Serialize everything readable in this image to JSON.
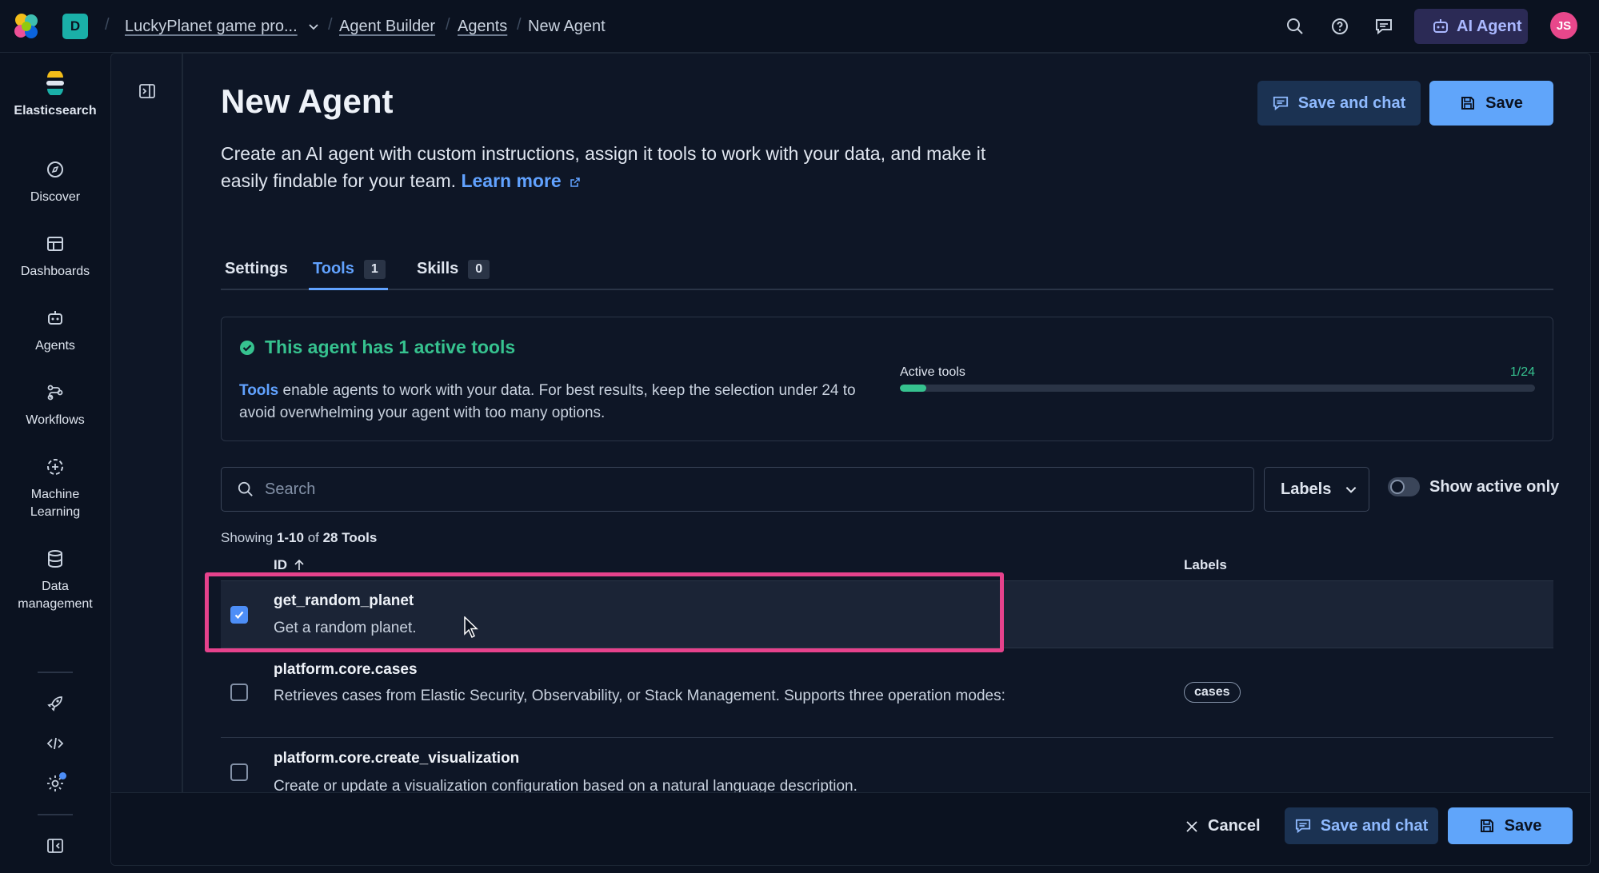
{
  "colors": {
    "accent": "#61a2ff",
    "success": "#36c28f",
    "highlight": "#e6428c",
    "space_badge": "#1ab0a8",
    "avatar": "#e8478b"
  },
  "header": {
    "space_initial": "D",
    "breadcrumbs": [
      "LuckyPlanet game pro...",
      "Agent Builder",
      "Agents",
      "New Agent"
    ],
    "ai_agent_label": "AI Agent",
    "avatar_initials": "JS"
  },
  "nav": {
    "items": [
      {
        "label": "Elasticsearch",
        "icon": "elasticsearch-logo-icon"
      },
      {
        "label": "Discover",
        "icon": "compass-icon"
      },
      {
        "label": "Dashboards",
        "icon": "dashboard-icon"
      },
      {
        "label": "Agents",
        "icon": "robot-icon"
      },
      {
        "label": "Workflows",
        "icon": "workflow-icon"
      },
      {
        "label": "Machine Learning",
        "icon": "machine-learning-icon"
      },
      {
        "label": "Data management",
        "icon": "database-icon"
      }
    ],
    "bottom_icons": [
      "rocket-icon",
      "code-icon",
      "gear-icon",
      "collapse-nav-icon"
    ]
  },
  "page": {
    "title": "New Agent",
    "description": "Create an AI agent with custom instructions, assign it tools to work with your data, and make it easily findable for your team.",
    "learn_more": "Learn more",
    "save_and_chat": "Save and chat",
    "save": "Save"
  },
  "tabs": [
    {
      "label": "Settings",
      "count": null
    },
    {
      "label": "Tools",
      "count": "1",
      "active": true
    },
    {
      "label": "Skills",
      "count": "0"
    }
  ],
  "callout": {
    "title": "This agent has 1 active tools",
    "link": "Tools",
    "text": " enable agents to work with your data. For best results, keep the selection under 24 to avoid overwhelming your agent with too many options.",
    "progress_label": "Active tools",
    "progress_count": "1/24",
    "progress_value": 1,
    "progress_max": 24
  },
  "filters": {
    "search_placeholder": "Search",
    "labels_button": "Labels",
    "show_active_only": "Show active only",
    "show_active_only_on": false
  },
  "table": {
    "showing_prefix": "Showing ",
    "showing_range": "1-10",
    "showing_of": " of ",
    "showing_total": "28",
    "showing_suffix": "Tools",
    "col_id": "ID",
    "col_labels": "Labels",
    "rows": [
      {
        "id": "get_random_planet",
        "description": "Get a random planet.",
        "label": "",
        "checked": true
      },
      {
        "id": "platform.core.cases",
        "description": "Retrieves cases from Elastic Security, Observability, or Stack Management. Supports three operation modes:",
        "label": "cases",
        "checked": false
      },
      {
        "id": "platform.core.create_visualization",
        "description": "Create or update a visualization configuration based on a natural language description.",
        "label": "",
        "checked": false
      }
    ]
  },
  "footer": {
    "cancel": "Cancel",
    "save_and_chat": "Save and chat",
    "save": "Save"
  }
}
